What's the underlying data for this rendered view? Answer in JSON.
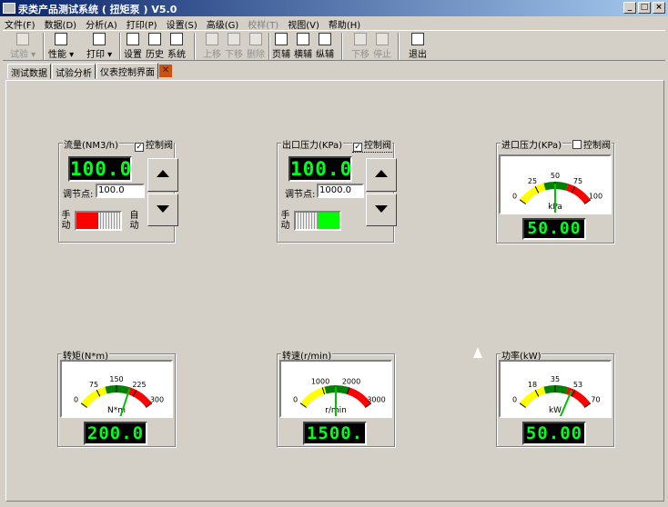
{
  "window": {
    "title": "汞类产品测试系统 ( 扭矩泵 )    V5.0",
    "buttons": {
      "min": "_",
      "max": "□",
      "close": "×"
    }
  },
  "menus": [
    {
      "label": "文件(F)",
      "disabled": false
    },
    {
      "label": "数据(D)",
      "disabled": false
    },
    {
      "label": "分析(A)",
      "disabled": false
    },
    {
      "label": "打印(P)",
      "disabled": false
    },
    {
      "label": "设置(S)",
      "disabled": false
    },
    {
      "label": "高级(G)",
      "disabled": false
    },
    {
      "label": "校样(T)",
      "disabled": true
    },
    {
      "label": "视图(V)",
      "disabled": false
    },
    {
      "label": "帮助(H)",
      "disabled": false
    }
  ],
  "toolbar": {
    "test": "试验",
    "curve": "性能",
    "print": "打印",
    "settings": "设置",
    "history": "历史",
    "system": "系统",
    "up": "上移",
    "down": "下移",
    "delete": "删除",
    "page_set": "页辅",
    "horizontal": "横辅",
    "vertical": "纵辅",
    "step_down": "下移",
    "stop": "停止",
    "exit": "退出"
  },
  "tabs": [
    "测试数据",
    "试验分析",
    "仪表控制界面"
  ],
  "flow": {
    "label": "流量(NM3/h)",
    "control": "控制阀",
    "checked": true,
    "value": "100.0",
    "setpoint_label": "调节点:",
    "setpoint": "100.0",
    "manual": "手动",
    "auto": "自动",
    "state_color": "#ff0000"
  },
  "outlet": {
    "label": "出口压力(KPa)",
    "control": "控制阀",
    "checked": true,
    "value": "100.0",
    "setpoint_label": "调节点:",
    "setpoint": "1000.0",
    "manual": "手动",
    "auto": "自动",
    "state_color": "#00ff00"
  },
  "inlet": {
    "label": "进口压力(KPa)",
    "control": "控制阀",
    "checked": false,
    "unit": "kPa",
    "value": "50.00",
    "ticks": [
      "0",
      "25",
      "50",
      "75",
      "100"
    ],
    "needle": 0.5,
    "min": 0,
    "max": 100
  },
  "torque": {
    "label": "转矩(N*m)",
    "unit": "N*m",
    "value": "200.0",
    "ticks": [
      "0",
      "75",
      "150",
      "225",
      "300"
    ],
    "needle": 0.6667,
    "min": 0,
    "max": 300
  },
  "speed": {
    "label": "转速(r/min)",
    "unit": "r/min",
    "value": "1500.",
    "ticks": [
      "0",
      "1000",
      "2000",
      "3000"
    ],
    "needle": 0.5,
    "min": 0,
    "max": 3000
  },
  "power": {
    "label": "功率(kW)",
    "unit": "kW",
    "value": "50.00",
    "ticks": [
      "0",
      "18",
      "35",
      "53",
      "70"
    ],
    "needle": 0.7143,
    "min": 0,
    "max": 70
  },
  "gauge_colors": {
    "yellow": "#ffff00",
    "green": "#008000",
    "red": "#ff0000",
    "needle": "#00c000"
  }
}
